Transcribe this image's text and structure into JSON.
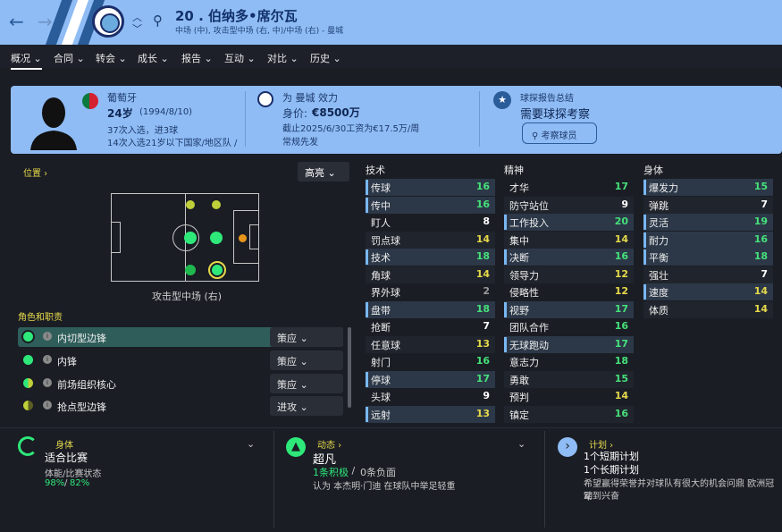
{
  "header": {
    "nav_back": "←",
    "nav_forward": "→",
    "player_title": "20 . 伯纳多•席尔瓦",
    "player_sub": "中场 (中), 攻击型中场 (右, 中)/中场 (右) - 曼城"
  },
  "tabs": [
    "概况",
    "合同",
    "转会",
    "成长",
    "报告",
    "互动",
    "对比",
    "历史"
  ],
  "card": {
    "nationality": "葡萄牙",
    "age": "24岁",
    "birth": "(1994/8/10)",
    "caps": "37次入选，进3球",
    "youth_caps": "14次入选21岁以下国家/地区队 /",
    "club_line": "为 曼城 效力",
    "value_label": "身价:",
    "value": "€8500万",
    "contract": "截止2025/6/30工资为€17.5万/周",
    "role_status": "常规先发",
    "scout_label": "球探报告总结",
    "scout_text": "需要球探考察",
    "scout_btn": "考察球员"
  },
  "position": {
    "title": "位置",
    "dropdown": "高亮",
    "caption": "攻击型中场 (右)"
  },
  "roles": {
    "title": "角色和职责",
    "items": [
      {
        "name": "内切型边锋",
        "duty": "策应"
      },
      {
        "name": "内锋",
        "duty": "策应"
      },
      {
        "name": "前场组织核心",
        "duty": "策应"
      },
      {
        "name": "抢点型边锋",
        "duty": "进攻"
      }
    ]
  },
  "attributes": {
    "tech_title": "技术",
    "mental_title": "精神",
    "physical_title": "身体",
    "technical": [
      {
        "name": "传球",
        "value": "16"
      },
      {
        "name": "传中",
        "value": "16"
      },
      {
        "name": "盯人",
        "value": "8"
      },
      {
        "name": "罚点球",
        "value": "14"
      },
      {
        "name": "技术",
        "value": "18"
      },
      {
        "name": "角球",
        "value": "14"
      },
      {
        "name": "界外球",
        "value": "2"
      },
      {
        "name": "盘带",
        "value": "18"
      },
      {
        "name": "抢断",
        "value": "7"
      },
      {
        "name": "任意球",
        "value": "13"
      },
      {
        "name": "射门",
        "value": "16"
      },
      {
        "name": "停球",
        "value": "17"
      },
      {
        "name": "头球",
        "value": "9"
      },
      {
        "name": "远射",
        "value": "13"
      }
    ],
    "mental": [
      {
        "name": "才华",
        "value": "17"
      },
      {
        "name": "防守站位",
        "value": "9"
      },
      {
        "name": "工作投入",
        "value": "20"
      },
      {
        "name": "集中",
        "value": "14"
      },
      {
        "name": "决断",
        "value": "16"
      },
      {
        "name": "领导力",
        "value": "12"
      },
      {
        "name": "侵略性",
        "value": "12"
      },
      {
        "name": "视野",
        "value": "17"
      },
      {
        "name": "团队合作",
        "value": "16"
      },
      {
        "name": "无球跑动",
        "value": "17"
      },
      {
        "name": "意志力",
        "value": "18"
      },
      {
        "name": "勇敢",
        "value": "15"
      },
      {
        "name": "预判",
        "value": "14"
      },
      {
        "name": "镇定",
        "value": "16"
      }
    ],
    "physical": [
      {
        "name": "爆发力",
        "value": "15"
      },
      {
        "name": "弹跳",
        "value": "7"
      },
      {
        "name": "灵活",
        "value": "19"
      },
      {
        "name": "耐力",
        "value": "16"
      },
      {
        "name": "平衡",
        "value": "18"
      },
      {
        "name": "强壮",
        "value": "7"
      },
      {
        "name": "速度",
        "value": "14"
      },
      {
        "name": "体质",
        "value": "14"
      }
    ]
  },
  "bottom": {
    "fitness_label": "身体",
    "fitness_status": "适合比赛",
    "fitness_sub": "体能/比赛状态",
    "fitness_pct1": "98%",
    "fitness_slash": "/",
    "fitness_pct2": "82%",
    "morale_label": "动态",
    "morale_value": "超凡",
    "morale_pos": "1条积极",
    "morale_sep": " / ",
    "morale_neg": "0条负面",
    "morale_text": "认为 本杰明·门迪 在球队中举足轻重",
    "plan_label": "计划",
    "plan_short": "1个短期计划",
    "plan_long": "1个长期计划",
    "plan_text1": "希望赢得荣誉并对球队有很大的机会问鼎 欧洲冠军",
    "plan_text2": "动到兴奋"
  },
  "colors": {
    "accent": "#8fbcf5",
    "good": "#2ee87a",
    "value_high": "#46e07a",
    "value_mid": "#e5d94b"
  }
}
